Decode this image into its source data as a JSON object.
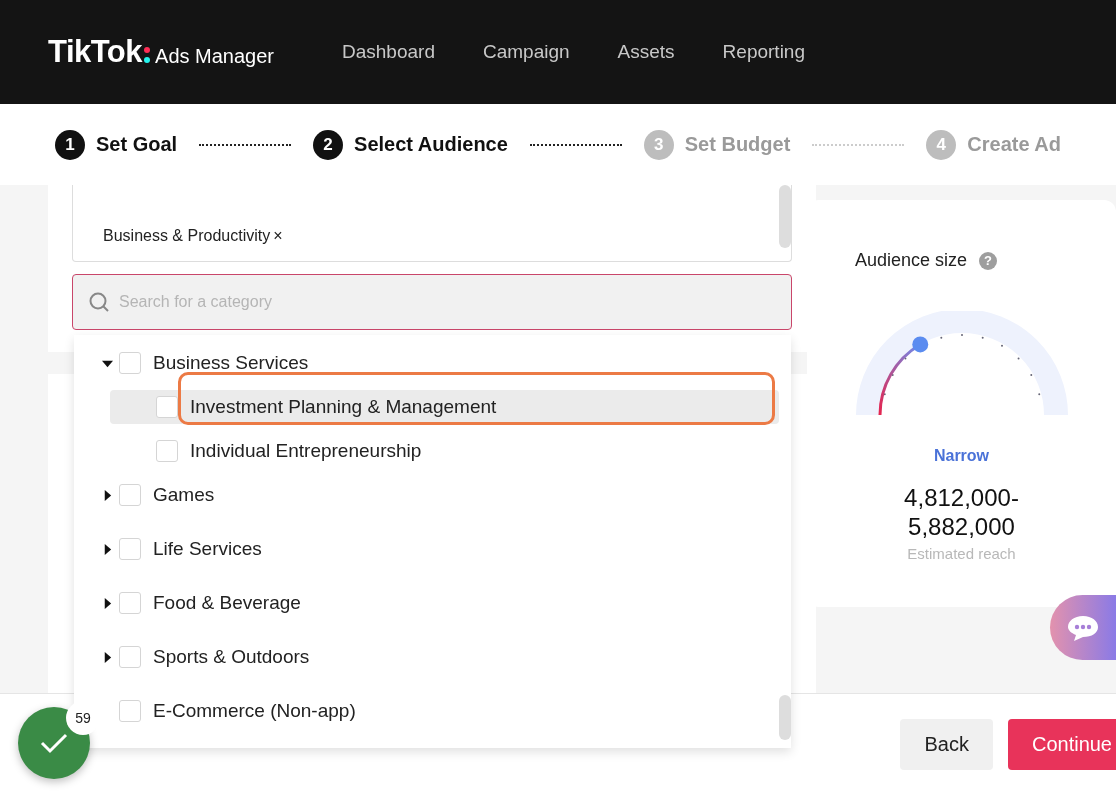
{
  "header": {
    "brand": "TikTok",
    "product": "Ads Manager",
    "nav": [
      {
        "label": "Dashboard"
      },
      {
        "label": "Campaign"
      },
      {
        "label": "Assets"
      },
      {
        "label": "Reporting"
      }
    ]
  },
  "steps": [
    {
      "number": "1",
      "label": "Set Goal",
      "active": true
    },
    {
      "number": "2",
      "label": "Select Audience",
      "active": true
    },
    {
      "number": "3",
      "label": "Set Budget",
      "active": false
    },
    {
      "number": "4",
      "label": "Create Ad",
      "active": false
    }
  ],
  "selected_tags": [
    {
      "label": "Business & Productivity",
      "remove": "×"
    }
  ],
  "search": {
    "placeholder": "Search for a category"
  },
  "categories": [
    {
      "label": "Business Services",
      "kind": "branch",
      "expanded": true,
      "checked": false,
      "children": [
        {
          "label": "Investment Planning & Management",
          "checked": false,
          "highlighted": true
        },
        {
          "label": "Individual Entrepreneurship",
          "checked": false,
          "highlighted": false
        }
      ]
    },
    {
      "label": "Games",
      "kind": "branch",
      "expanded": false,
      "checked": false
    },
    {
      "label": "Life Services",
      "kind": "branch",
      "expanded": false,
      "checked": false
    },
    {
      "label": "Food & Beverage",
      "kind": "branch",
      "expanded": false,
      "checked": false
    },
    {
      "label": "Sports & Outdoors",
      "kind": "branch",
      "expanded": false,
      "checked": false
    },
    {
      "label": "E-Commerce (Non-app)",
      "kind": "leaf",
      "checked": false
    }
  ],
  "audience": {
    "title": "Audience size",
    "help": "?",
    "gauge": {
      "level": 0.33
    },
    "rating": "Narrow",
    "reach": "4,812,000-\n5,882,000",
    "reach_label": "Estimated reach"
  },
  "progress_badge": {
    "count": "59"
  },
  "buttons": [
    {
      "label": "Back",
      "kind": "secondary"
    },
    {
      "label": "Continue",
      "kind": "primary"
    }
  ]
}
